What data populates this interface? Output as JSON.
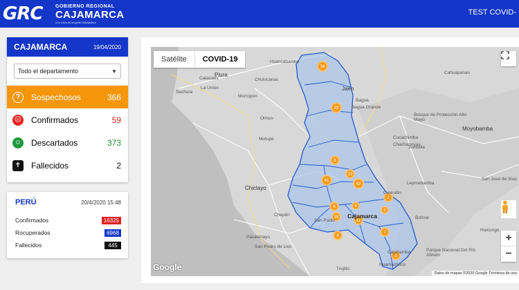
{
  "header": {
    "logo_letters": "GRC",
    "logo_line1": "GOBIERNO REGIONAL",
    "logo_line2": "CAJAMARCA",
    "logo_tagline": "A la cuna de la gente trabajadora",
    "test_link": "TEST COVID-"
  },
  "region_panel": {
    "title": "CAJAMARCA",
    "date": "19/04/2020",
    "select_value": "Todo el departamento",
    "stats": [
      {
        "label": "Sospechosos",
        "value": "366",
        "icon": "help-circle-icon"
      },
      {
        "label": "Confirmados",
        "value": "59",
        "icon": "sad-face-icon"
      },
      {
        "label": "Descartados",
        "value": "373",
        "icon": "happy-face-icon"
      },
      {
        "label": "Fallecidos",
        "value": "2",
        "icon": "coffin-icon"
      }
    ]
  },
  "peru_panel": {
    "title": "PERÚ",
    "date": "20/4/2020 15:48",
    "rows": [
      {
        "label": "Confirmados",
        "value": "16325",
        "color": "#e02020"
      },
      {
        "label": "Rocuperados",
        "value": "6968",
        "color": "#1436c9"
      },
      {
        "label": "Fallecidos",
        "value": "445",
        "color": "#111111"
      }
    ]
  },
  "map": {
    "type_buttons": [
      "Satélite",
      "COVID-19"
    ],
    "google_logo": "Google",
    "attribution": "Datos de mapas ©2020 Google   Términos de uso",
    "cluster_counts": [
      "34",
      "32",
      "6",
      "41",
      "13",
      "42",
      "2",
      "6",
      "18",
      "11",
      "7",
      "8",
      "3",
      "2",
      "4"
    ],
    "places": [
      "Huancabamba",
      "Catacaos",
      "Piura",
      "La Unión",
      "Sechura",
      "Chulucanas",
      "Morropón",
      "Jaén",
      "Bagua",
      "Bagua Grande",
      "Cahuapanas",
      "Bosque de Protección Alto Mayo",
      "Moyobamba",
      "Cocachimba",
      "Chachapoyas",
      "Jumbilla",
      "Motupe",
      "Chiclayo",
      "Cajamarca",
      "San Pablo",
      "Pacasmayo",
      "San Pedro de Lloc",
      "Celendín",
      "Leymebamba",
      "Bolívar",
      "Cajabamba",
      "Huamachuco",
      "Parque Nacional Del Río Abiseo",
      "San José de Sisa",
      "Huicungo",
      "Trujillo",
      "Chepén",
      "Olmos"
    ]
  }
}
